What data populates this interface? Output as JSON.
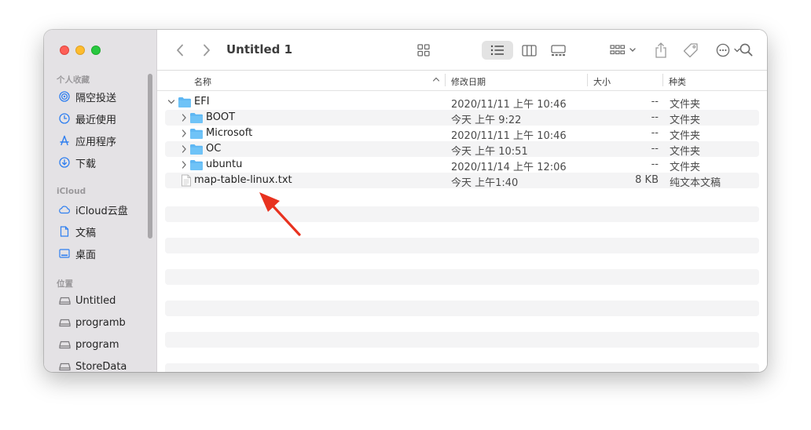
{
  "window": {
    "title": "Untitled 1"
  },
  "sidebar": {
    "favorites_title": "个人收藏",
    "favorites": [
      {
        "label": "隔空投送",
        "icon": "airdrop-icon"
      },
      {
        "label": "最近使用",
        "icon": "clock-icon"
      },
      {
        "label": "应用程序",
        "icon": "applications-icon"
      },
      {
        "label": "下载",
        "icon": "download-icon"
      }
    ],
    "icloud_title": "iCloud",
    "icloud": [
      {
        "label": "iCloud云盘",
        "icon": "cloud-icon"
      },
      {
        "label": "文稿",
        "icon": "document-icon"
      },
      {
        "label": "桌面",
        "icon": "desktop-icon"
      }
    ],
    "locations_title": "位置",
    "locations": [
      {
        "label": "Untitled",
        "icon": "disk-icon"
      },
      {
        "label": "programb",
        "icon": "disk-icon"
      },
      {
        "label": "program",
        "icon": "disk-icon"
      },
      {
        "label": "StoreData",
        "icon": "disk-icon"
      }
    ]
  },
  "columns": {
    "name": "名称",
    "date": "修改日期",
    "size": "大小",
    "kind": "种类"
  },
  "files": [
    {
      "name": "EFI",
      "date": "2020/11/11 上午 10:46",
      "size": "--",
      "kind": "文件夹",
      "type": "folder",
      "expanded": true,
      "indent": 0
    },
    {
      "name": "BOOT",
      "date": "今天 上午 9:22",
      "size": "--",
      "kind": "文件夹",
      "type": "folder",
      "expanded": false,
      "indent": 1
    },
    {
      "name": "Microsoft",
      "date": "2020/11/11 上午 10:46",
      "size": "--",
      "kind": "文件夹",
      "type": "folder",
      "expanded": false,
      "indent": 1
    },
    {
      "name": "OC",
      "date": "今天 上午 10:51",
      "size": "--",
      "kind": "文件夹",
      "type": "folder",
      "expanded": false,
      "indent": 1
    },
    {
      "name": "ubuntu",
      "date": "2020/11/14 上午 12:06",
      "size": "--",
      "kind": "文件夹",
      "type": "folder",
      "expanded": false,
      "indent": 1
    },
    {
      "name": "map-table-linux.txt",
      "date": "今天 上午1:40",
      "size": "8 KB",
      "kind": "纯文本文稿",
      "type": "text",
      "indent": 0
    }
  ],
  "colors": {
    "folder": "#5eb7f3",
    "accent_arrow": "#e8321f"
  }
}
